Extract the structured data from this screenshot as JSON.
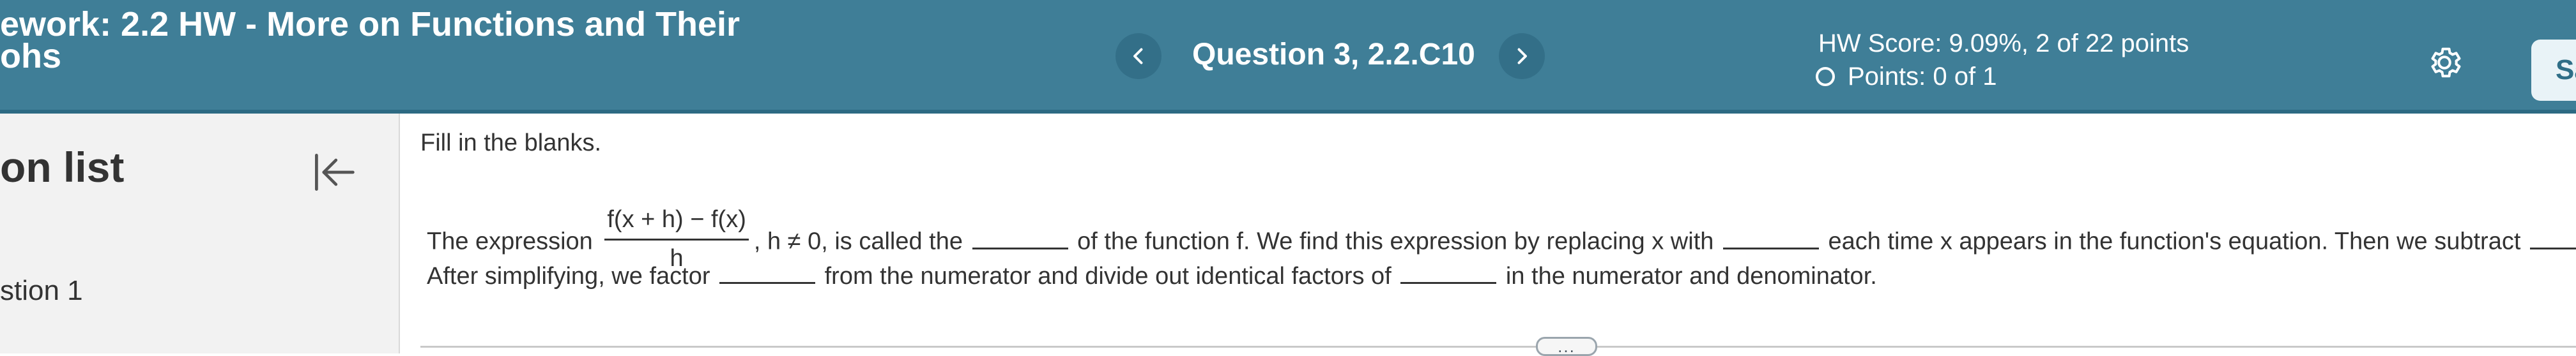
{
  "header": {
    "title_line1": "ework:  2.2 HW - More on Functions and Their",
    "title_line2": "ohs",
    "question_label": "Question 3, 2.2.C10",
    "hw_score": "HW Score: 9.09%, 2 of 22 points",
    "points": "Points: 0 of 1",
    "save_label": "Sa",
    "prev_icon": "chevron-left-icon",
    "next_icon": "chevron-right-icon",
    "settings_icon": "gear-icon"
  },
  "sidebar": {
    "title": "on list",
    "collapse_icon": "collapse-left-icon",
    "items": [
      {
        "label": "stion 1"
      }
    ]
  },
  "question": {
    "instruction": "Fill in the blanks.",
    "line1": {
      "prefix": "The expression",
      "frac_num": "f(x + h) − f(x)",
      "frac_den": "h",
      "part1": ", h ≠ 0, is called the",
      "part2": "of the function f. We find this expression by replacing x with",
      "part3": "each time x appears in the function's equation. Then we subtract",
      "suffix": "."
    },
    "line2": {
      "part1": "After simplifying, we factor",
      "part2": "from the numerator and divide out identical factors of",
      "part3": "in the numerator and denominator."
    },
    "more_label": "..."
  },
  "colors": {
    "header_bg": "#3f7e97",
    "header_text": "#ffffff",
    "sidebar_bg": "#f2f2f2",
    "body_text": "#333333"
  }
}
